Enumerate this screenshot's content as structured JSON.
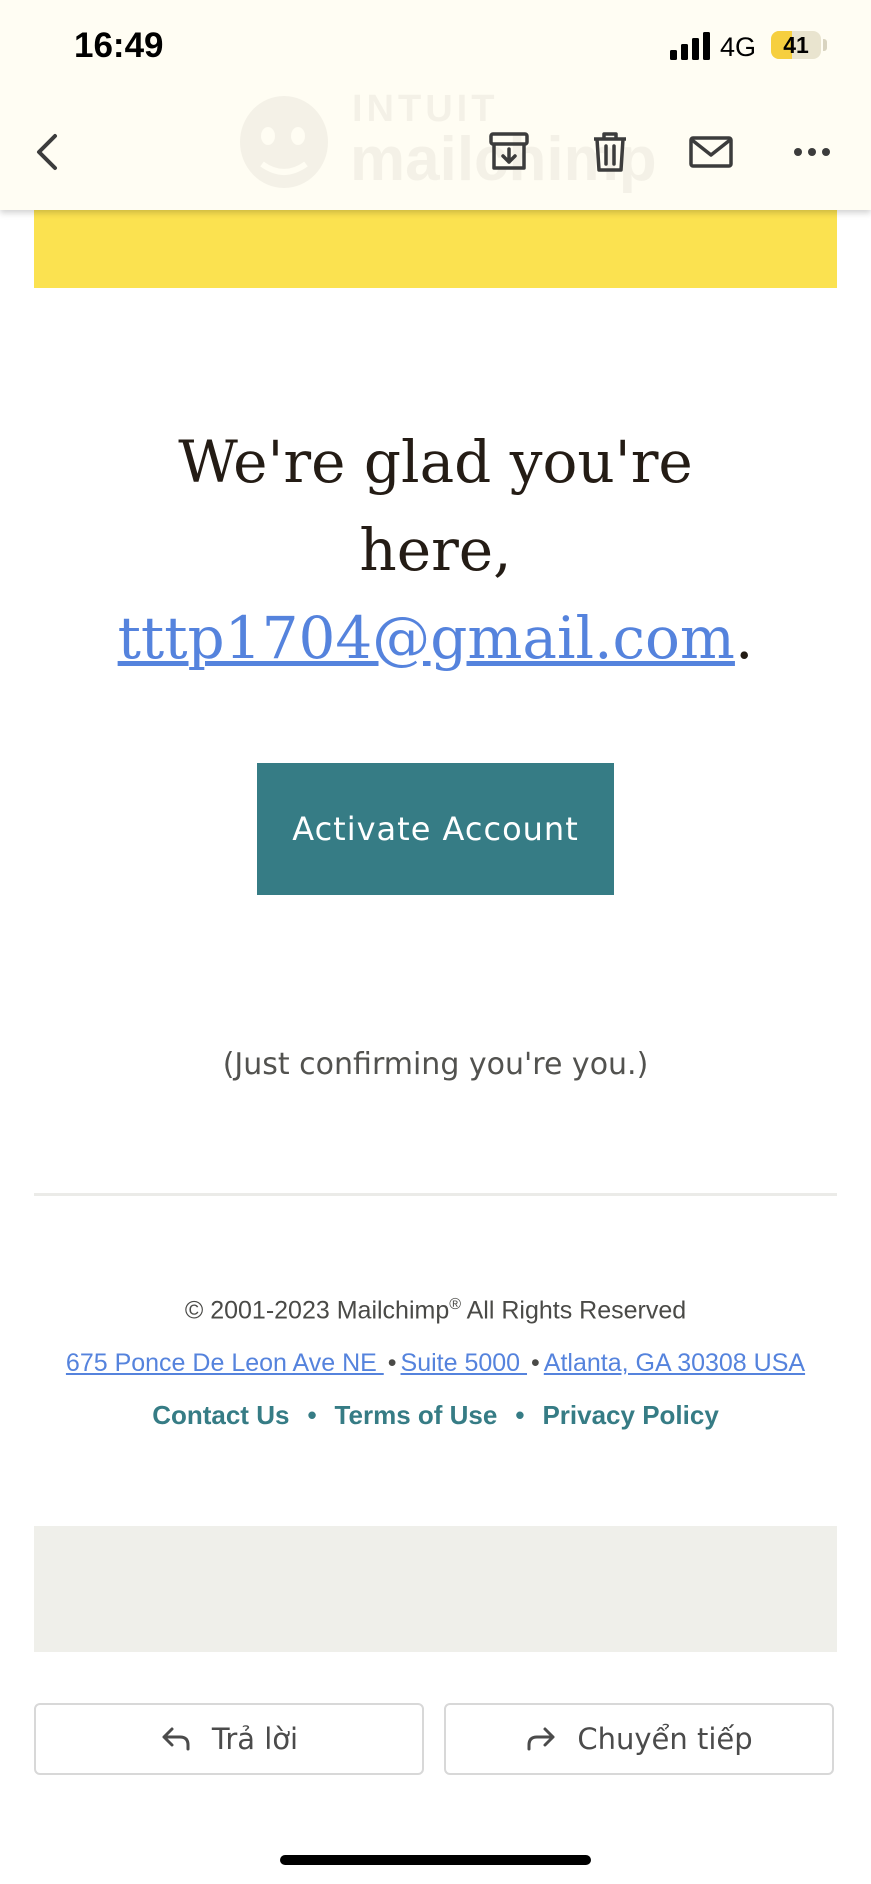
{
  "status_bar": {
    "time": "16:49",
    "network": "4G",
    "battery": "41",
    "battery_level": 0.41
  },
  "toolbar": {
    "back_icon": "chevron-left-icon",
    "archive_icon": "archive-icon",
    "delete_icon": "trash-icon",
    "mark_unread_icon": "mail-icon",
    "more_icon": "more-horizontal-icon",
    "watermark_brand": "INTUIT",
    "watermark_product": "mailchimp"
  },
  "email": {
    "headline_line1": "We're glad you're",
    "headline_line2": "here,",
    "headline_email": "tttp1704@gmail.com",
    "headline_period": ".",
    "activate_button": "Activate Account",
    "confirm_note": "(Just confirming you're you.)"
  },
  "footer": {
    "copyright_prefix": "© 2001-2023 Mailchimp",
    "registered_mark": "®",
    "copyright_suffix": " All Rights Reserved",
    "address_street": "675 Ponce De Leon Ave NE ",
    "address_suite": "Suite 5000 ",
    "address_city": "Atlanta, GA 30308 USA",
    "address_separator": "•",
    "link_contact": "Contact Us",
    "link_terms": "Terms of Use",
    "link_privacy": "Privacy Policy",
    "link_separator": "•"
  },
  "actions": {
    "reply_label": "Trả lời",
    "forward_label": "Chuyển tiếp"
  },
  "colors": {
    "brand_yellow": "#fbe250",
    "button_teal": "#367c85",
    "link_blue": "#5583dd"
  }
}
